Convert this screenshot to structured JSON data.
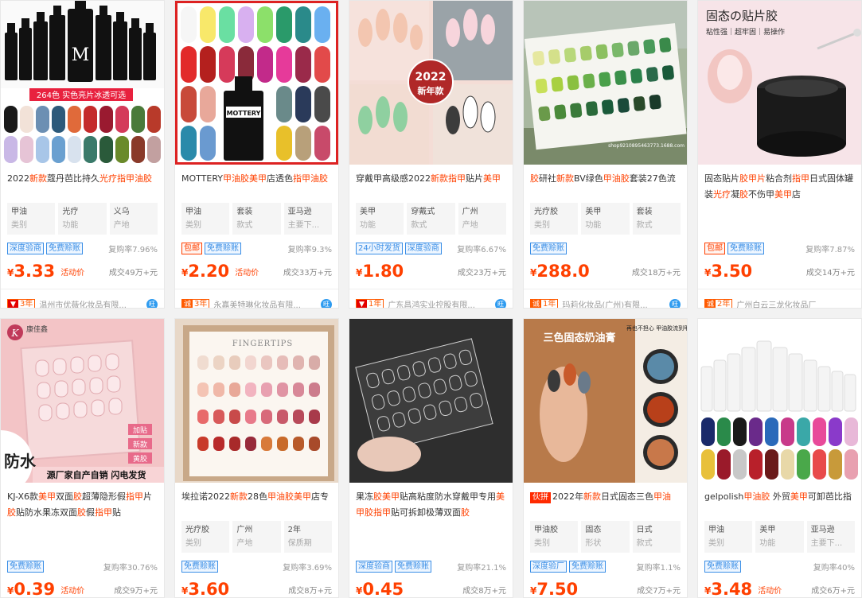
{
  "products": [
    {
      "title": "2022新款蔻丹芭比持久光疗指甲油胶",
      "img_text": "264色 实色亮片冰透可选",
      "attrs": [
        {
          "v": "甲油",
          "k": "类别"
        },
        {
          "v": "光疗",
          "k": "功能"
        },
        {
          "v": "义乌",
          "k": "产地"
        }
      ],
      "tags": [
        "深度验商",
        "免费赊账"
      ],
      "tag_colors": [
        "blue",
        "blue"
      ],
      "repurchase": "复购率7.96%",
      "price": "3.33",
      "activity": "活动价",
      "sold": "成交49万+元",
      "years": "3年",
      "seller": "温州市优薇化妆品有限..."
    },
    {
      "title": "MOTTERY甲油胶美甲店透色指甲油胶",
      "img_text": "MOTTERY",
      "attrs": [
        {
          "v": "甲油",
          "k": "类别"
        },
        {
          "v": "套装",
          "k": "款式"
        },
        {
          "v": "亚马逊",
          "k": "主要下..."
        }
      ],
      "tags": [
        "包邮",
        "免费赊账"
      ],
      "tag_colors": [
        "red",
        "blue"
      ],
      "repurchase": "复购率9.3%",
      "price": "2.20",
      "activity": "活动价",
      "sold": "成交33万+元",
      "years": "3年",
      "seller": "永嘉美特琳化妆品有限..."
    },
    {
      "title": "穿戴甲高级感2022新款指甲贴片美甲",
      "img_text": "2022\n新年款",
      "attrs": [
        {
          "v": "美甲",
          "k": "功能"
        },
        {
          "v": "穿戴式",
          "k": "款式"
        },
        {
          "v": "广州",
          "k": "产地"
        }
      ],
      "tags": [
        "24小时发货",
        "深度验商"
      ],
      "tag_colors": [
        "blue",
        "blue"
      ],
      "repurchase": "复购率6.67%",
      "price": "1.80",
      "activity": "",
      "sold": "成交23万+元",
      "years": "1年",
      "seller": "广东昌鸿实业控股有限..."
    },
    {
      "title": "胶研社新款BV绿色甲油胶套装27色流",
      "img_text": "shop9210895463773.1688.com",
      "attrs": [
        {
          "v": "光疗胶",
          "k": "类别"
        },
        {
          "v": "美甲",
          "k": "功能"
        },
        {
          "v": "套装",
          "k": "款式"
        }
      ],
      "tags": [
        "免费赊账"
      ],
      "tag_colors": [
        "blue"
      ],
      "repurchase": "",
      "price": "288.0",
      "activity": "",
      "sold": "成交18万+元",
      "years": "1年",
      "seller": "玛莉化妆品(广州)有限..."
    },
    {
      "title": "固态贴片胶甲片粘合剂指甲日式固体罐装光疗凝胶不伤甲美甲店",
      "img_text": "固态の贴片胶",
      "img_sub": "粘性强｜超牢固｜易操作",
      "attrs": [],
      "tags": [
        "包邮",
        "免费赊账"
      ],
      "tag_colors": [
        "red",
        "blue"
      ],
      "repurchase": "复购率7.87%",
      "price": "3.50",
      "activity": "",
      "sold": "成交14万+元",
      "years": "2年",
      "seller": "广州白云三龙化妆品厂"
    },
    {
      "title": "KJ-X6款美甲双面胶超薄隐形假指甲片胶贴防水果冻双面胶假指甲贴",
      "img_text": "防水",
      "img_sub": "源厂家自产自销 闪电发货",
      "img_brand": "康佳鑫",
      "img_side": [
        "加贴",
        "新款",
        "黄胶"
      ],
      "attrs": [],
      "tags": [
        "免费赊账"
      ],
      "tag_colors": [
        "blue"
      ],
      "repurchase": "复购率30.76%",
      "price": "0.39",
      "activity": "活动价",
      "sold": "成交9万+元"
    },
    {
      "title": "埃拉诺2022新款28色甲油胶美甲店专",
      "img_text": "FINGERTIPS",
      "attrs": [
        {
          "v": "光疗胶",
          "k": "类别"
        },
        {
          "v": "广州",
          "k": "产地"
        },
        {
          "v": "2年",
          "k": "保质期"
        }
      ],
      "tags": [
        "免费赊账"
      ],
      "tag_colors": [
        "blue"
      ],
      "repurchase": "复购率3.69%",
      "price": "3.60",
      "activity": "",
      "sold": "成交8万+元"
    },
    {
      "title": "果冻胶美甲贴高粘度防水穿戴甲专用美甲胶指甲贴可拆卸极薄双面胶",
      "attrs": [],
      "tags": [
        "深度验商",
        "免费赊账"
      ],
      "tag_colors": [
        "blue",
        "blue"
      ],
      "repurchase": "复购率21.1%",
      "price": "0.45",
      "activity": "",
      "sold": "成交8万+元"
    },
    {
      "title": "2022年新款日式固态三色甲油",
      "title_badge": "伙拼",
      "img_text": "三色固态奶油膏",
      "img_sub": "再也不担心 甲油胶流到甲缝",
      "attrs": [
        {
          "v": "甲油胶",
          "k": "类别"
        },
        {
          "v": "固态",
          "k": "形状"
        },
        {
          "v": "日式",
          "k": "款式"
        }
      ],
      "tags": [
        "深度验厂",
        "免费赊账"
      ],
      "tag_colors": [
        "blue",
        "blue"
      ],
      "repurchase": "复购率1.1%",
      "price": "7.50",
      "activity": "",
      "sold": "成交7万+元"
    },
    {
      "title": "gelpolish甲油胶 外贸美甲可卸芭比指",
      "attrs": [
        {
          "v": "甲油",
          "k": "类别"
        },
        {
          "v": "美甲",
          "k": "功能"
        },
        {
          "v": "亚马逊",
          "k": "主要下..."
        }
      ],
      "tags": [
        "免费赊账"
      ],
      "tag_colors": [
        "blue"
      ],
      "repurchase": "复购率40%",
      "price": "3.48",
      "activity": "活动价",
      "sold": "成交6万+元"
    }
  ],
  "currency": "¥",
  "cheng_icon": "诚",
  "wang_icon": "旺",
  "colors": {
    "accent": "#ff4000",
    "tag_blue": "#3a8ee6",
    "bg": "#f2f2f2"
  }
}
